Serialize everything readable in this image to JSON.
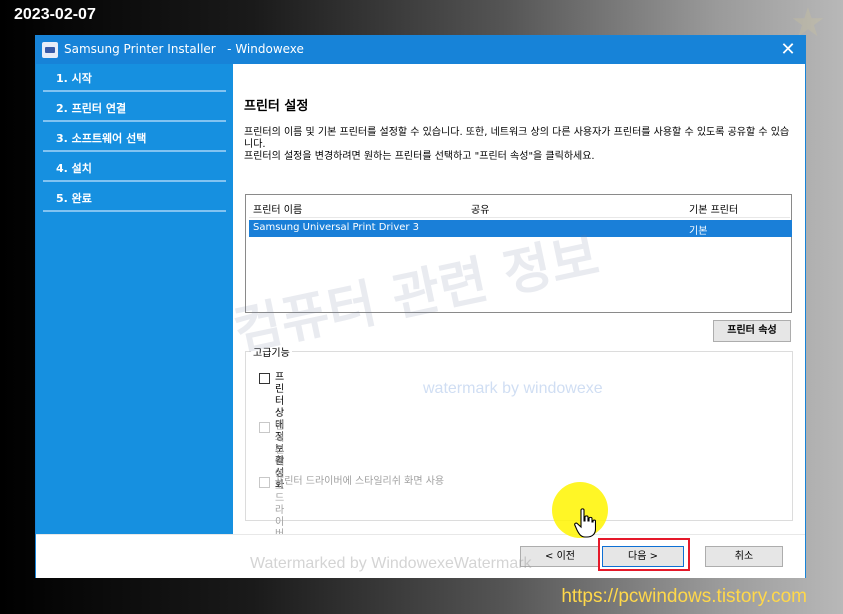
{
  "date_stamp": "2023-02-07",
  "url_stamp": "https://pcwindows.tistory.com",
  "window": {
    "title": "Samsung Printer Installer   - Windowexe",
    "close_glyph": "✕"
  },
  "sidebar": {
    "items": [
      {
        "label": "1. 시작"
      },
      {
        "label": "2. 프린터 연결"
      },
      {
        "label": "3. 소프트웨어 선택"
      },
      {
        "label": "4. 설치"
      },
      {
        "label": "5. 완료"
      }
    ]
  },
  "main": {
    "title": "프린터 설정",
    "description_1": "프린터의 이름 및 기본 프린터를 설정할 수 있습니다. 또한, 네트워크 상의 다른 사용자가 프린터를 사용할 수 있도록 공유할 수 있습니다.",
    "description_2": "프린터의 설정을 변경하려면 원하는 프린터를 선택하고 \"프린터 속성\"을 클릭하세요.",
    "list": {
      "headers": {
        "name": "프린터 이름",
        "share": "공유",
        "default": "기본 프린터"
      },
      "rows": [
        {
          "name": "Samsung Universal Print Driver 3",
          "share": "",
          "default": "기본"
        }
      ]
    },
    "properties_button": "프린터 속성",
    "advanced": {
      "label": "고급기능",
      "options": [
        {
          "label": "프린터 상태 정보 활성화",
          "checked": false,
          "enabled": true
        },
        {
          "label": "인쇄 전에 에코 드라이버 시작",
          "checked": false,
          "enabled": false
        },
        {
          "label": "프린터 드라이버에 스타일리쉬 화면 사용",
          "checked": false,
          "enabled": false
        }
      ]
    }
  },
  "footer": {
    "prev_button": "< 이전",
    "next_button": "다음 >",
    "cancel_button": "취소"
  },
  "watermarks": {
    "korean": "컴퓨터 관련 정보",
    "english": "watermark by windowexe",
    "bottom": "Watermarked by WindowexeWatermark"
  },
  "colors": {
    "titlebar": "#1783d8",
    "sidebar": "#1690e0",
    "selection": "#1a7fd8",
    "highlight": "#e5192a"
  }
}
